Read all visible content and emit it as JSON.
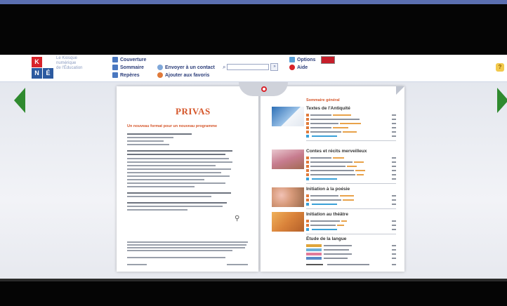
{
  "logo": {
    "letters": [
      "K",
      "N",
      "É"
    ],
    "colors": [
      "#d8232a",
      "#2c5aa0",
      "#2c5aa0"
    ],
    "tagline": [
      "Le Kiosque",
      "numérique",
      "de l'Éducation"
    ]
  },
  "toolbar": {
    "couverture": "Couverture",
    "sommaire": "Sommaire",
    "reperes": "Repères",
    "envoyer": "Envoyer à un contact",
    "ajouter": "Ajouter aux favoris",
    "options": "Options",
    "aide": "Aide"
  },
  "search": {
    "value": "",
    "go_label": "»"
  },
  "help": {
    "icon": "help-icon"
  },
  "left_page": {
    "heading": "PRIVAS",
    "subheading": "Un nouveau format pour un nouveau programme"
  },
  "right_page": {
    "title": "Sommaire général",
    "sections": [
      {
        "title": "Textes de l'Antiquité",
        "image_color": "#3d7fbf"
      },
      {
        "title": "Contes et récits merveilleux",
        "image_color": "#c87a8a"
      },
      {
        "title": "Initiation à la poésie",
        "image_color": "#d79a7a"
      },
      {
        "title": "Initiation au théâtre",
        "image_color": "#d98a3a"
      },
      {
        "title": "Étude de la langue",
        "image_color": ""
      }
    ]
  },
  "colors": {
    "accent": "#d5562a",
    "nav": "#2f8a2f",
    "brand_blue": "#2c3e7a"
  }
}
